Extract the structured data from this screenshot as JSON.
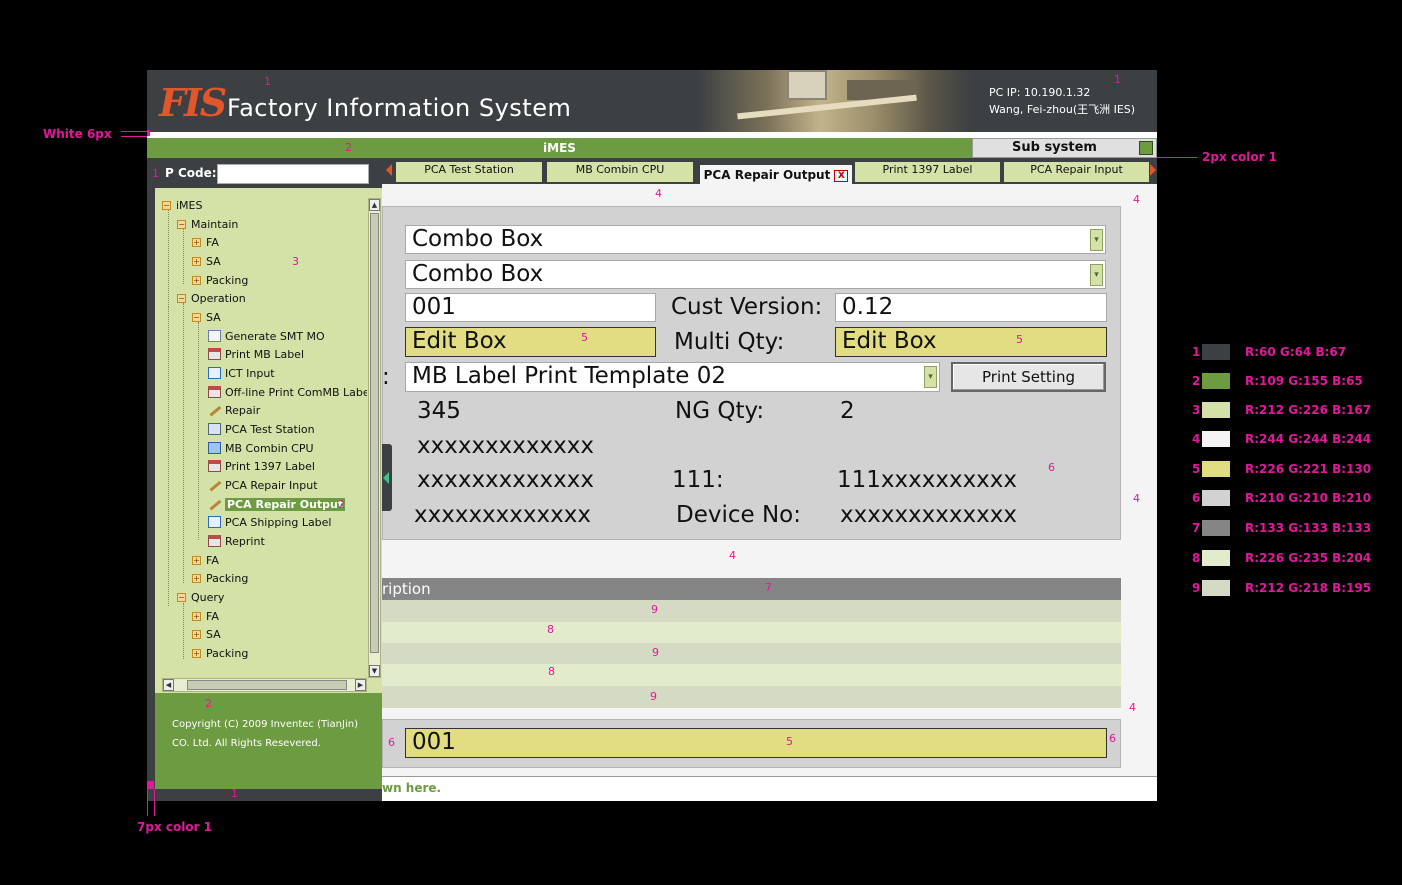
{
  "header": {
    "logo": "FIS",
    "title": "Factory Information System",
    "pc_ip": "PC IP: 10.190.1.32",
    "user": "Wang, Fei-zhou(王飞洲  IES)"
  },
  "nav": {
    "system_name": "iMES",
    "subsystem_label": "Sub system"
  },
  "left": {
    "pcode_label": "P Code:",
    "pcode_value": "",
    "copyright_line1": "Copyright (C) 2009 Inventec (TianJin)",
    "copyright_line2": "CO.  Ltd. All Rights Resevered."
  },
  "tree": {
    "root": "iMES",
    "maintain": "Maintain",
    "maintain_fa": "FA",
    "maintain_sa": "SA",
    "maintain_packing": "Packing",
    "operation": "Operation",
    "op_sa": "SA",
    "items": [
      "Generate SMT MO",
      "Print MB Label",
      "ICT Input",
      "Off-line Print ComMB Labe",
      "Repair",
      "PCA Test Station",
      "MB Combin CPU",
      "Print 1397 Label",
      "PCA Repair Input",
      "PCA Repair Output",
      "PCA Shipping Label",
      "Reprint"
    ],
    "op_fa": "FA",
    "op_packing": "Packing",
    "query": "Query",
    "query_fa": "FA",
    "query_sa": "SA",
    "query_packing": "Packing"
  },
  "tabs": [
    "PCA Test Station",
    "MB Combin CPU",
    "PCA Repair Output",
    "Print 1397 Label",
    "PCA Repair Input"
  ],
  "tab_close": "X",
  "form": {
    "combo1": "Combo Box",
    "combo2": "Combo Box",
    "field_001": "001",
    "cust_version_label": "Cust Version:",
    "cust_version_value": "0.12",
    "edit1": "Edit Box",
    "multi_qty_label": "Multi Qty:",
    "edit2": "Edit Box",
    "template_colon": ":",
    "template_value": "MB Label Print Template 02",
    "print_setting": "Print Setting",
    "val_345": "345",
    "ng_qty_label": "NG Qty:",
    "ng_qty_value": "2",
    "x1": "xxxxxxxxxxxxx",
    "x2": "xxxxxxxxxxxxx",
    "label_111": "111:",
    "value_111": "111xxxxxxxxxx",
    "x3": "xxxxxxxxxxxxx",
    "device_no_label": "Device No:",
    "device_no_value": "xxxxxxxxxxxxx"
  },
  "grid": {
    "header": "ription"
  },
  "bottom": {
    "input_value": "001",
    "status_text": "wn here."
  },
  "annotations": {
    "white_6px": "White  6px",
    "color1_2px": "2px color 1",
    "color1_7px": "7px color 1",
    "markers": [
      "1",
      "2",
      "3",
      "4",
      "5",
      "6",
      "7",
      "8",
      "9"
    ]
  },
  "legend": [
    {
      "num": "1",
      "color": "#3c4043",
      "text": "R:60  G:64  B:67"
    },
    {
      "num": "2",
      "color": "#6d9b41",
      "text": "R:109  G:155  B:65"
    },
    {
      "num": "3",
      "color": "#d4e2a7",
      "text": "R:212  G:226  B:167"
    },
    {
      "num": "4",
      "color": "#f4f4f4",
      "text": "R:244  G:244  B:244"
    },
    {
      "num": "5",
      "color": "#e2dd82",
      "text": "R:226  G:221  B:130"
    },
    {
      "num": "6",
      "color": "#d2d2d2",
      "text": "R:210  G:210  B:210"
    },
    {
      "num": "7",
      "color": "#858585",
      "text": "R:133  G:133  B:133"
    },
    {
      "num": "8",
      "color": "#e2ebcc",
      "text": "R:226  G:235  B:204"
    },
    {
      "num": "9",
      "color": "#d4dac3",
      "text": "R:212  G:218  B:195"
    }
  ]
}
